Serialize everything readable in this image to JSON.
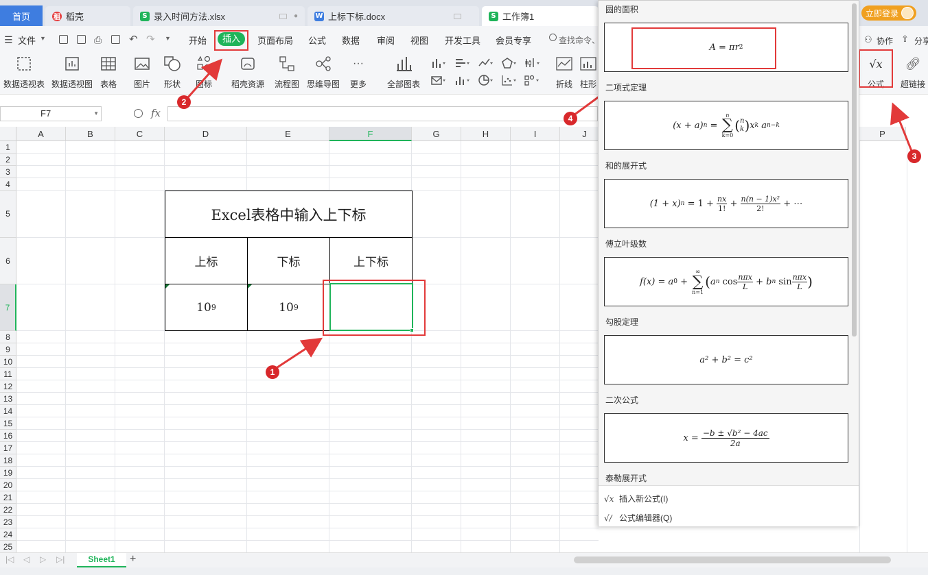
{
  "tabs": [
    {
      "label": "首页"
    },
    {
      "label": "稻壳"
    },
    {
      "label": "录入时间方法.xlsx"
    },
    {
      "label": "上标下标.docx"
    },
    {
      "label": "工作簿1"
    }
  ],
  "account": {
    "login_label": "立即登录"
  },
  "menu": {
    "file": "文件",
    "items": [
      "开始",
      "插入",
      "页面布局",
      "公式",
      "数据",
      "审阅",
      "视图",
      "开发工具",
      "会员专享"
    ],
    "search": "查找命令、",
    "collab": "协作",
    "share": "分享"
  },
  "toolbar": {
    "pivot_table": "数据透视表",
    "pivot_chart": "数据透视图",
    "table": "表格",
    "picture": "图片",
    "shape": "形状",
    "icon": "图标",
    "docer": "稻壳资源",
    "flowchart": "流程图",
    "mindmap": "思维导图",
    "more": "更多",
    "all_charts": "全部图表",
    "line": "折线",
    "column": "柱形",
    "formula": "公式",
    "hyperlink": "超链接"
  },
  "formula_bar": {
    "name_box": "F7",
    "fx": "fx"
  },
  "grid": {
    "columns": [
      "A",
      "B",
      "C",
      "D",
      "E",
      "F",
      "G",
      "H",
      "I",
      "J",
      "P"
    ],
    "rows": [
      "1",
      "2",
      "3",
      "4",
      "5",
      "6",
      "7",
      "8",
      "9",
      "10",
      "11",
      "12",
      "13",
      "14",
      "15",
      "16",
      "17",
      "18",
      "19",
      "20",
      "21",
      "22",
      "23",
      "24",
      "25"
    ],
    "table": {
      "title": "Excel表格中输入上下标",
      "headers": [
        "上标",
        "下标",
        "上下标"
      ],
      "base1": "10",
      "sup1": "9",
      "base2": "10",
      "sub2": "9"
    }
  },
  "formula_panel": {
    "sections": [
      {
        "title": "圆的面积"
      },
      {
        "title": "二项式定理"
      },
      {
        "title": "和的展开式"
      },
      {
        "title": "傅立叶级数"
      },
      {
        "title": "勾股定理"
      },
      {
        "title": "二次公式"
      },
      {
        "title": "泰勒展开式"
      }
    ],
    "formulas": {
      "circle": {
        "lhs": "A",
        "eq": " = ",
        "pi_r": "πr",
        "exp": "2"
      },
      "binomial": {
        "lhs": "(x + a)",
        "n": "n",
        "eq": " = ",
        "top": "n",
        "bot": "k=0",
        "sigma": "∑",
        "term": "x",
        "k": "k",
        "a": "a",
        "nk": "n−k",
        "binn": "n",
        "bink": "k"
      },
      "sum": {
        "text": "(1 + x)",
        "n": "n",
        "rest": " = 1 + ",
        "f1n": "nx",
        "f1d": "1!",
        "plus": " + ",
        "f2n": "n(n − 1)x²",
        "f2d": "2!",
        "tail": " + ⋯"
      },
      "fourier": {
        "lhs": "f(x) = a",
        "sub0": "0",
        "plus": " + ",
        "top": "∞",
        "bot": "n=1",
        "sigma": "∑",
        "an": "a",
        "nsub": "n",
        "cos": " cos",
        "f1n": "nπx",
        "f1d": "L",
        "bn": " + b",
        "sin": " sin",
        "f2n": "nπx",
        "f2d": "L"
      },
      "pythagoras": {
        "text": "a² + b² = c²"
      },
      "quadratic": {
        "lhs": "x = ",
        "num": "−b ± √b² − 4ac",
        "den": "2a"
      }
    },
    "insert_new": "插入新公式(I)",
    "editor": "公式编辑器(Q)"
  },
  "sheet": {
    "name": "Sheet1",
    "add": "+"
  },
  "annotations": [
    "1",
    "2",
    "3",
    "4"
  ],
  "colors": {
    "accent_green": "#1fb45a",
    "annotation_red": "#e23a3a",
    "login_orange": "#f0a020"
  }
}
